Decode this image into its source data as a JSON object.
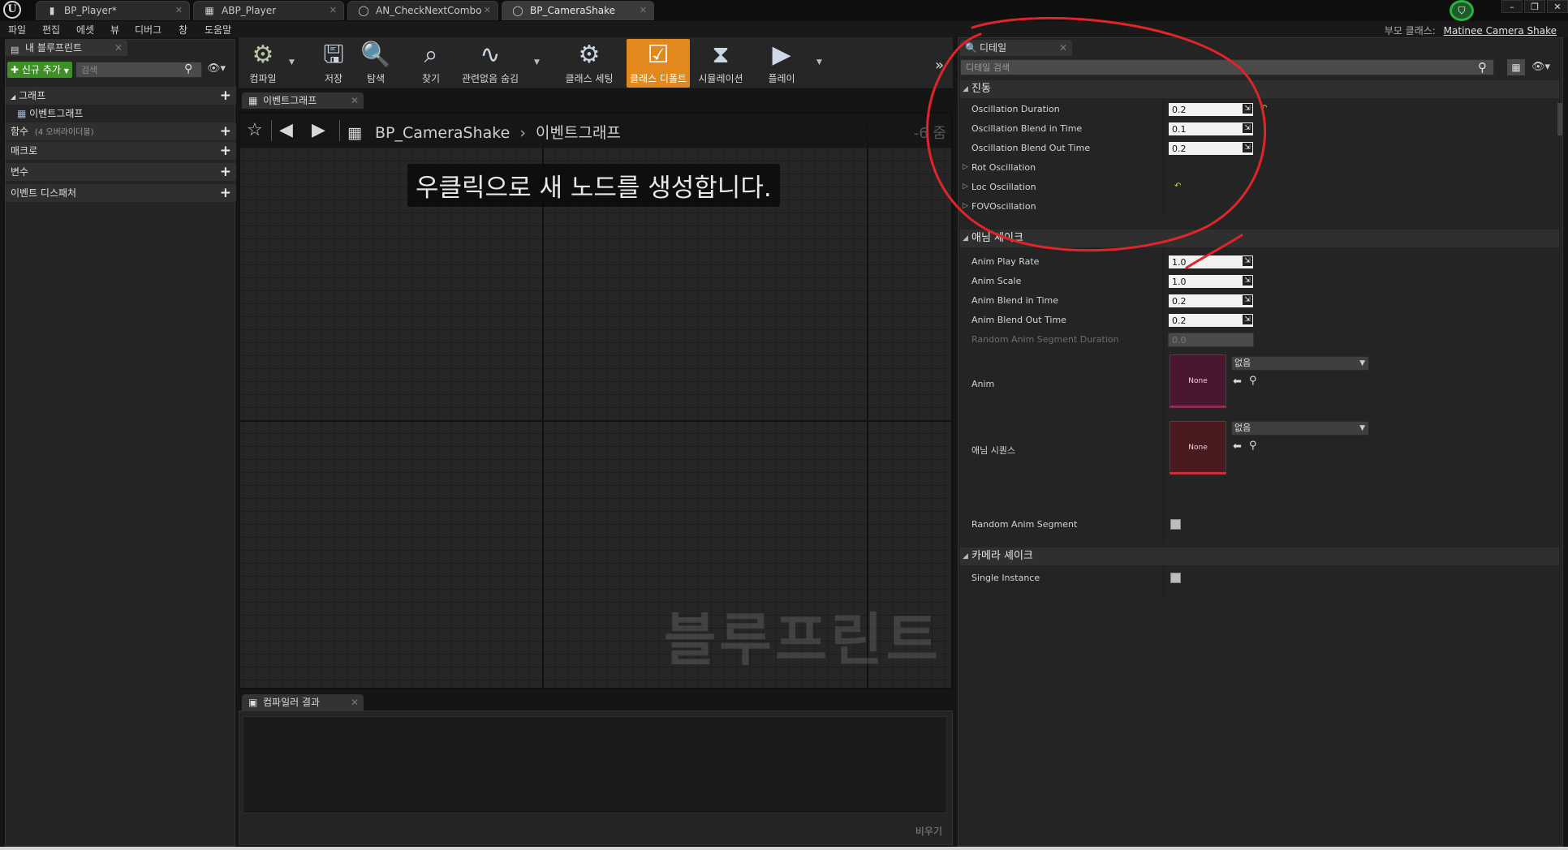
{
  "title_bar": {
    "tabs": [
      {
        "label": "BP_Player*",
        "icon": "blueprint-icon"
      },
      {
        "label": "ABP_Player",
        "icon": "anim-blueprint-icon"
      },
      {
        "label": "AN_CheckNextCombo",
        "icon": "blueprint-class-icon"
      },
      {
        "label": "BP_CameraShake",
        "icon": "blueprint-class-icon",
        "active": true
      }
    ],
    "window_buttons": [
      "–",
      "❐",
      "✕"
    ]
  },
  "menu": {
    "items": [
      "파일",
      "편집",
      "에셋",
      "뷰",
      "디버그",
      "창",
      "도움말"
    ],
    "parent_class_label": "부모 클래스:",
    "parent_class_value": "Matinee Camera Shake"
  },
  "my_blueprint": {
    "tab_label": "내 블루프린트",
    "add_new_label": "신규 추가",
    "search_placeholder": "검색",
    "sections": {
      "graphs": "그래프",
      "event_graph": "이벤트그래프",
      "functions": "함수",
      "functions_sub": "(4 오버라이더블)",
      "macros": "매크로",
      "variables": "변수",
      "event_dispatchers": "이벤트 디스패처"
    }
  },
  "toolbar": {
    "compile": "컴파일",
    "save": "저장",
    "browse": "탐색",
    "find": "찾기",
    "hide_unrelated": "관련없음 숨김",
    "class_settings": "클래스 세팅",
    "class_defaults": "클래스 디폴트",
    "simulation": "시뮬레이션",
    "play": "플레이"
  },
  "graph": {
    "tab_label": "이벤트그래프",
    "breadcrumb_root": "BP_CameraShake",
    "breadcrumb_leaf": "이벤트그래프",
    "zoom": "-6 줌",
    "hint": "우클릭으로 새 노드를 생성합니다.",
    "watermark": "블루프린트"
  },
  "compiler": {
    "tab_label": "컴파일러 결과",
    "clear_label": "비우기"
  },
  "details": {
    "tab_label": "디테일",
    "search_placeholder": "디테일 검색",
    "oscillation": {
      "header": "진동",
      "duration_label": "Oscillation Duration",
      "duration_value": "0.2",
      "blend_in_label": "Oscillation Blend in Time",
      "blend_in_value": "0.1",
      "blend_out_label": "Oscillation Blend Out Time",
      "blend_out_value": "0.2",
      "rot_label": "Rot Oscillation",
      "loc_label": "Loc Oscillation",
      "fov_label": "FOVOscillation"
    },
    "anim_shake": {
      "header": "애님 셰이크",
      "play_rate_label": "Anim Play Rate",
      "play_rate_value": "1.0",
      "scale_label": "Anim Scale",
      "scale_value": "1.0",
      "blend_in_label": "Anim Blend in Time",
      "blend_in_value": "0.2",
      "blend_out_label": "Anim Blend Out Time",
      "blend_out_value": "0.2",
      "random_duration_label": "Random Anim Segment Duration",
      "random_duration_value": "0.0",
      "anim_label": "Anim",
      "anim_thumb": "None",
      "anim_combo": "없음",
      "sequence_label": "애님 시퀀스",
      "sequence_thumb": "None",
      "sequence_combo": "없음",
      "random_segment_label": "Random Anim Segment",
      "random_segment_checked": false
    },
    "camera_shake": {
      "header": "카메라 셰이크",
      "single_instance_label": "Single Instance",
      "single_instance_checked": false
    }
  },
  "colors": {
    "accent_orange": "#e3881c",
    "add_green": "#3e8f26",
    "annotation_red": "#e0242a",
    "anim_thumb": "#4a1630",
    "sequence_thumb": "#4a1a1e"
  }
}
